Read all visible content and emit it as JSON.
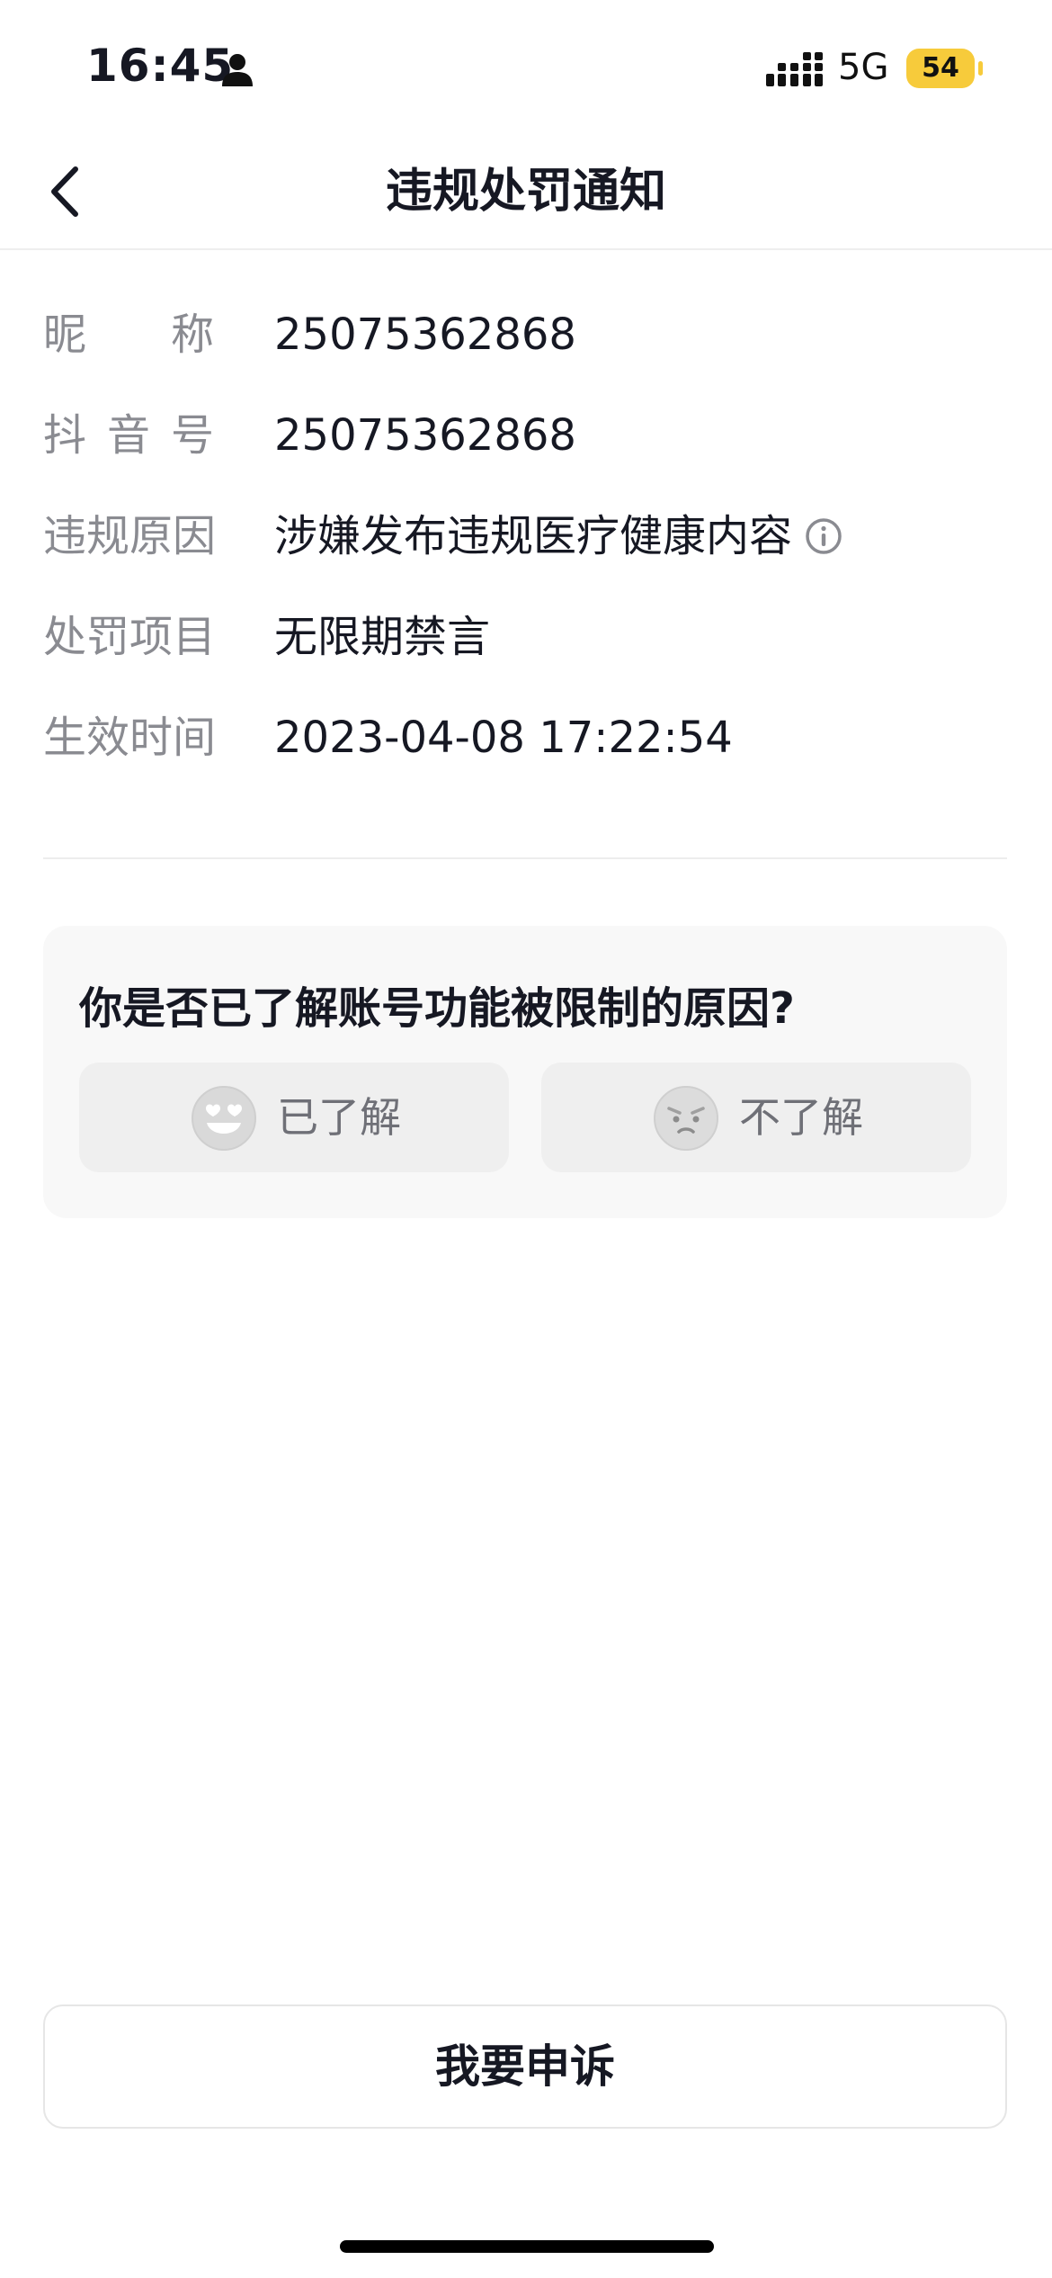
{
  "status_bar": {
    "time": "16:45",
    "network": "5G",
    "battery_level": "54",
    "battery_color": "#f7cb3b",
    "icons": [
      "person-icon",
      "signal-icon"
    ]
  },
  "nav": {
    "back_icon": "chevron-left-icon",
    "title": "违规处罚通知"
  },
  "info": {
    "nickname": {
      "label_chars": [
        "昵",
        "称"
      ],
      "value": "25075362868"
    },
    "douyin_id": {
      "label_chars": [
        "抖",
        "音",
        "号"
      ],
      "value": "25075362868"
    },
    "reason": {
      "label": "违规原因",
      "value": "涉嫌发布违规医疗健康内容",
      "icon": "info-icon"
    },
    "penalty": {
      "label": "处罚项目",
      "value": "无限期禁言"
    },
    "effective": {
      "label": "生效时间",
      "value": "2023-04-08 17:22:54"
    }
  },
  "survey": {
    "question": "你是否已了解账号功能被限制的原因?",
    "options": [
      {
        "label": "已了解",
        "icon": "heart-eyes-emoji-icon"
      },
      {
        "label": "不了解",
        "icon": "confused-emoji-icon"
      }
    ]
  },
  "appeal": {
    "label": "我要申诉"
  },
  "colors": {
    "label_gray": "#8a8b91",
    "text": "#161823",
    "card_bg": "#f8f8f8"
  }
}
